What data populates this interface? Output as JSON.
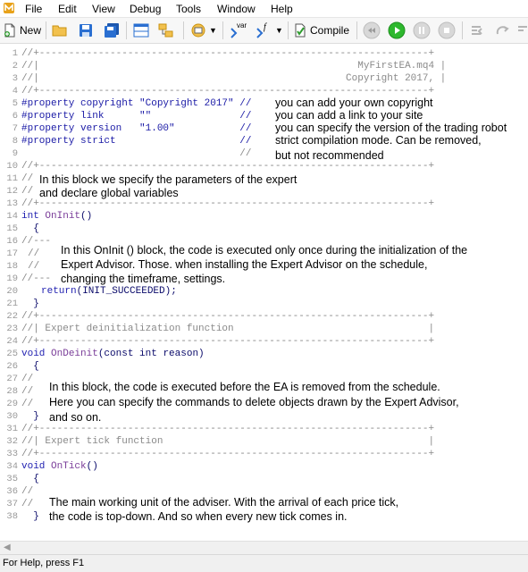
{
  "menu": [
    "File",
    "Edit",
    "View",
    "Debug",
    "Tools",
    "Window",
    "Help"
  ],
  "toolbar": {
    "new_label": "New",
    "var_label": "var",
    "fx_label": "f",
    "compile_label": "Compile"
  },
  "editor": {
    "line_numbers": [
      "1",
      "2",
      "3",
      "4",
      "5",
      "6",
      "7",
      "8",
      "9",
      "10",
      "11",
      "12",
      "13",
      "14",
      "15",
      "16",
      "17",
      "18",
      "19",
      "20",
      "21",
      "22",
      "23",
      "24",
      "25",
      "26",
      "27",
      "28",
      "29",
      "30",
      "31",
      "32",
      "33",
      "34",
      "35",
      "36",
      "37",
      "38"
    ],
    "lines": [
      "//+------------------------------------------------------------------+",
      "//|                                                      MyFirstEA.mq4 |",
      "//|                                                    Copyright 2017, |",
      "//+------------------------------------------------------------------+",
      "",
      "",
      "",
      "",
      "",
      "//+------------------------------------------------------------------+",
      "",
      "",
      "//+------------------------------------------------------------------+",
      "",
      "  {",
      "",
      "",
      "",
      "",
      "",
      "  }",
      "//+------------------------------------------------------------------+",
      "//| Expert deinitialization function                                 |",
      "//+------------------------------------------------------------------+",
      "",
      "  {",
      "",
      "",
      "",
      "  }",
      "//+------------------------------------------------------------------+",
      "//| Expert tick function                                             |",
      "//+------------------------------------------------------------------+",
      "",
      "  {",
      "",
      "",
      "  }"
    ],
    "prop_copyright": "#property copyright \"Copyright 2017\" //",
    "prop_link": "#property link      \"\"               //",
    "prop_version": "#property version   \"1.00\"           //",
    "prop_strict": "#property strict                     //",
    "prop_blank": "                                     //",
    "oninit_kw": "int",
    "oninit_name": "OnInit",
    "oninit_parens": "()",
    "ondeinit_kw": "void",
    "ondeinit_name": "OnDeinit",
    "ondeinit_args": "(const int reason)",
    "ontick_kw": "void",
    "ontick_name": "OnTick",
    "ontick_parens": "()",
    "return_kw": "return",
    "return_args": "(INIT_SUCCEEDED);",
    "c_dash_start": "//---",
    "c_slashes": "//",
    "c_dash_end": "//---",
    "c_block1": "//",
    "c_block2": "//",
    "c_d1": "//",
    "c_d2": "//",
    "c_d3": "//",
    "c_t1": "//",
    "c_t2": "//"
  },
  "annotations": {
    "copyright": "you can add your own copyright",
    "link": "you can add a link to your site",
    "version": "you can specify the version of the trading robot",
    "strict1": "strict compilation mode. Can be removed,",
    "strict2": "but not recommended",
    "block1": "In this block we specify the parameters of the expert",
    "block2": "and declare global variables",
    "oninit1": "In this OnInit () block, the code is executed only once during the initialization of the",
    "oninit2": "Expert Advisor. Those. when installing the Expert Advisor on the schedule,",
    "oninit3": "changing the timeframe, settings.",
    "deinit1": "In this block, the code is executed before the EA is removed from the schedule.",
    "deinit2": "Here you can specify the commands to delete objects drawn by the Expert Advisor,",
    "deinit3": "and so on.",
    "tick1": "The main working unit of the adviser. With the arrival of each price tick,",
    "tick2": "the code is top-down. And so when every new tick comes in."
  },
  "status": "For Help, press F1"
}
